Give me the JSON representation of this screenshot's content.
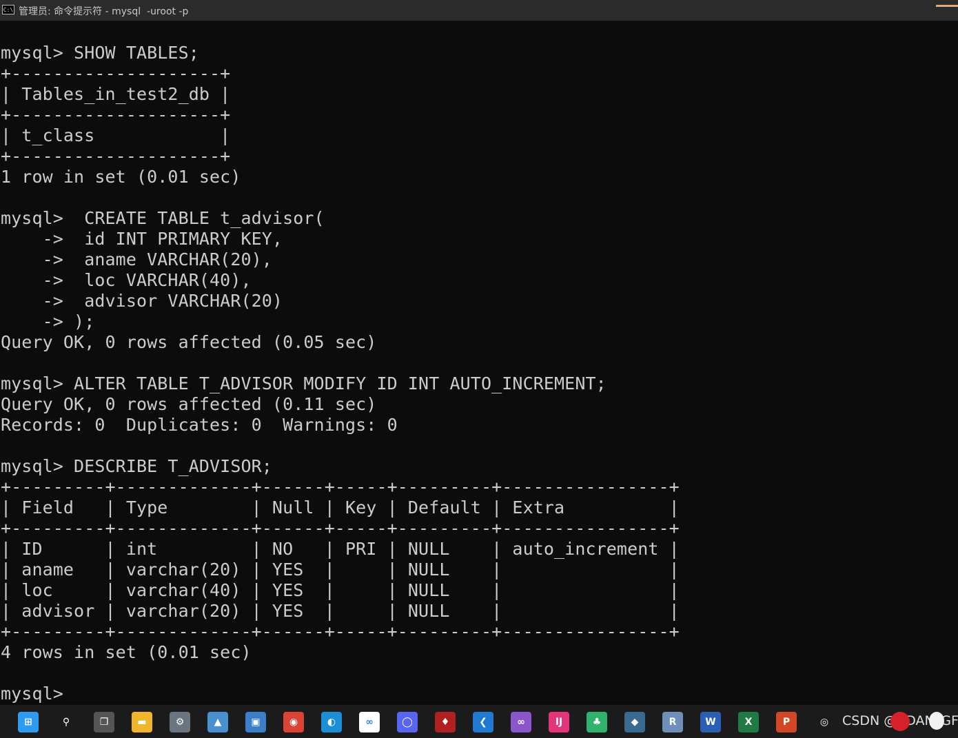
{
  "window": {
    "title": "管理员: 命令提示符 - mysql  -uroot -p",
    "icon_label": "C:\\"
  },
  "terminal": {
    "lines": [
      "mysql> SHOW TABLES;",
      "+--------------------+",
      "| Tables_in_test2_db |",
      "+--------------------+",
      "| t_class            |",
      "+--------------------+",
      "1 row in set (0.01 sec)",
      "",
      "mysql>  CREATE TABLE t_advisor(",
      "    ->  id INT PRIMARY KEY,",
      "    ->  aname VARCHAR(20),",
      "    ->  loc VARCHAR(40),",
      "    ->  advisor VARCHAR(20)",
      "    -> );",
      "Query OK, 0 rows affected (0.05 sec)",
      "",
      "mysql> ALTER TABLE T_ADVISOR MODIFY ID INT AUTO_INCREMENT;",
      "Query OK, 0 rows affected (0.11 sec)",
      "Records: 0  Duplicates: 0  Warnings: 0",
      "",
      "mysql> DESCRIBE T_ADVISOR;",
      "+---------+-------------+------+-----+---------+----------------+",
      "| Field   | Type        | Null | Key | Default | Extra          |",
      "+---------+-------------+------+-----+---------+----------------+",
      "| ID      | int         | NO   | PRI | NULL    | auto_increment |",
      "| aname   | varchar(20) | YES  |     | NULL    |                |",
      "| loc     | varchar(40) | YES  |     | NULL    |                |",
      "| advisor | varchar(20) | YES  |     | NULL    |                |",
      "+---------+-------------+------+-----+---------+----------------+",
      "4 rows in set (0.01 sec)",
      "",
      "mysql>"
    ]
  },
  "taskbar": {
    "apps": [
      {
        "name": "windows-start-icon",
        "color": "#2f9bf0",
        "glyph": "⊞"
      },
      {
        "name": "search-icon",
        "color": "#1b1b1c",
        "glyph": "⚲"
      },
      {
        "name": "task-view-icon",
        "color": "#555555",
        "glyph": "❐"
      },
      {
        "name": "file-explorer-icon",
        "color": "#f0b52a",
        "glyph": "▬"
      },
      {
        "name": "settings-gear-icon",
        "color": "#6a7580",
        "glyph": "⚙"
      },
      {
        "name": "photos-icon",
        "color": "#4a8fd0",
        "glyph": "▲"
      },
      {
        "name": "control-panel-icon",
        "color": "#3a7fc8",
        "glyph": "▣"
      },
      {
        "name": "chrome-icon",
        "color": "#d94436",
        "glyph": "◉"
      },
      {
        "name": "edge-icon",
        "color": "#1d8fd6",
        "glyph": "◐"
      },
      {
        "name": "baidu-netdisk-icon",
        "color": "#ffffff",
        "glyph": "∞"
      },
      {
        "name": "circle-app-icon",
        "color": "#5865f2",
        "glyph": "◯"
      },
      {
        "name": "game-app-icon",
        "color": "#b02020",
        "glyph": "♦"
      },
      {
        "name": "vscode-icon",
        "color": "#1f7ad0",
        "glyph": "❮"
      },
      {
        "name": "visual-studio-icon",
        "color": "#8a56c9",
        "glyph": "∞"
      },
      {
        "name": "intellij-icon",
        "color": "#e2357a",
        "glyph": "IJ"
      },
      {
        "name": "pycharm-icon",
        "color": "#2fb36a",
        "glyph": "♣"
      },
      {
        "name": "mysql-workbench-icon",
        "color": "#3b6a90",
        "glyph": "◆"
      },
      {
        "name": "r-icon",
        "color": "#6f8fb8",
        "glyph": "R"
      },
      {
        "name": "word-icon",
        "color": "#2b5fb3",
        "glyph": "W"
      },
      {
        "name": "excel-icon",
        "color": "#1f7a44",
        "glyph": "X"
      },
      {
        "name": "powerpoint-icon",
        "color": "#d24726",
        "glyph": "P"
      },
      {
        "name": "obs-icon",
        "color": "#1b1b1c",
        "glyph": "◎"
      }
    ],
    "tray_text": "CSDN @ADAN_GF"
  }
}
